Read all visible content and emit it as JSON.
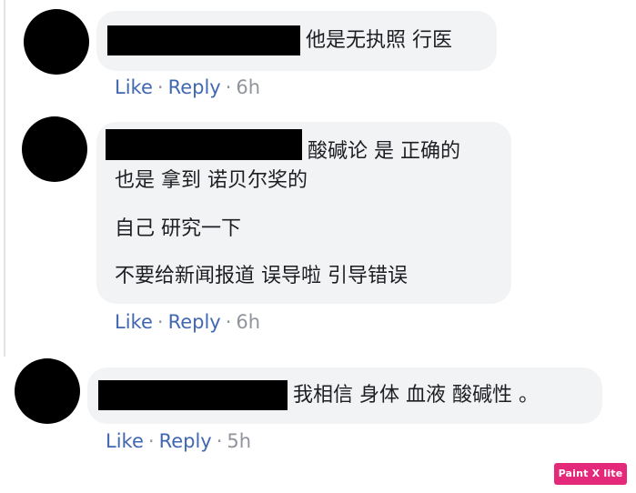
{
  "comments": [
    {
      "lines": [
        "他是无执照 行医"
      ],
      "like_label": "Like",
      "reply_label": "Reply",
      "separator": "·",
      "time": "6h"
    },
    {
      "lines": [
        "酸碱论 是 正确的",
        "也是 拿到 诺贝尔奖的",
        "自己 研究一下",
        "不要给新闻报道 误导啦 引导错误"
      ],
      "like_label": "Like",
      "reply_label": "Reply",
      "separator": "·",
      "time": "6h"
    },
    {
      "lines": [
        "我相信 身体 血液 酸碱性 。"
      ],
      "like_label": "Like",
      "reply_label": "Reply",
      "separator": "·",
      "time": "5h"
    }
  ],
  "watermark": "Paint X lite",
  "colors": {
    "link": "#4267b2",
    "muted": "#90949c",
    "bubble": "#f2f3f5",
    "watermark": "#e4287a"
  }
}
